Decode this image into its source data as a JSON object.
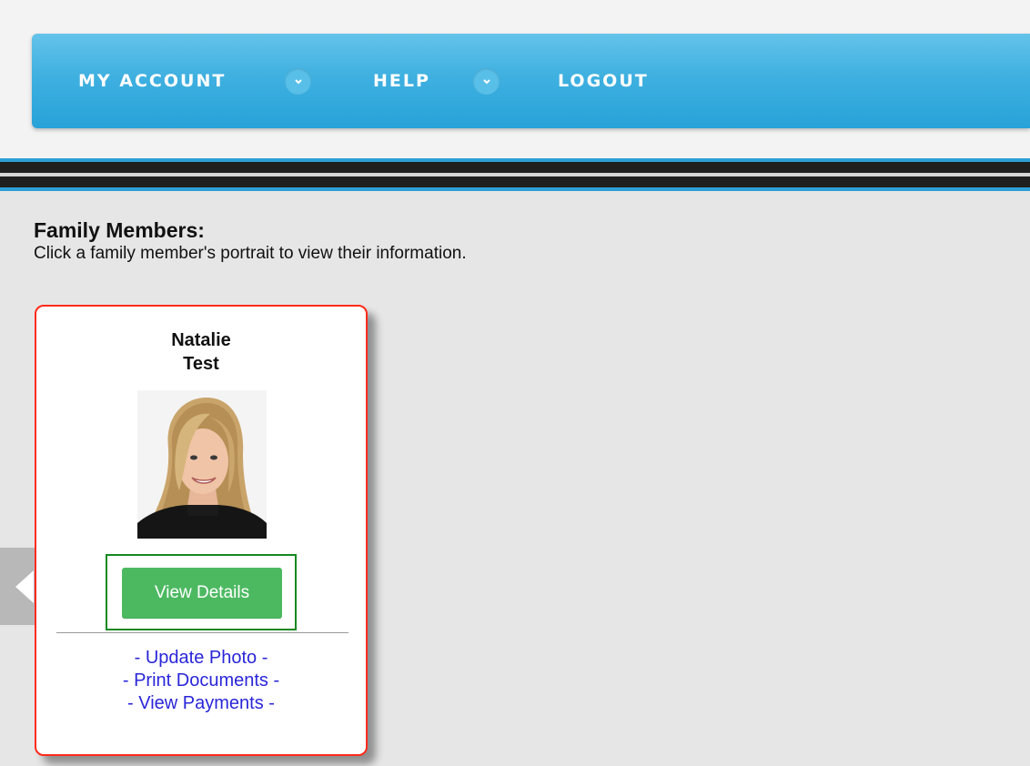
{
  "nav": {
    "items": [
      {
        "label": "MY ACCOUNT",
        "has_dropdown": true
      },
      {
        "label": "HELP",
        "has_dropdown": true
      },
      {
        "label": "LOGOUT",
        "has_dropdown": false
      }
    ],
    "dropdown_icon": "chevron-down-icon"
  },
  "family": {
    "title": "Family Members:",
    "instructions": "Click a family member's portrait to view their information."
  },
  "member": {
    "first_name": "Natalie",
    "last_name": "Test",
    "view_details_label": "View Details",
    "links": [
      "- Update Photo -",
      "- Print Documents -",
      "- View Payments -"
    ]
  },
  "carousel": {
    "prev_icon": "chevron-left-icon"
  },
  "colors": {
    "nav_blue": "#3fb0e0",
    "card_border": "#ff2a1a",
    "button_green": "#4cb961",
    "button_frame": "#12891f",
    "link_blue": "#2a26d8"
  }
}
